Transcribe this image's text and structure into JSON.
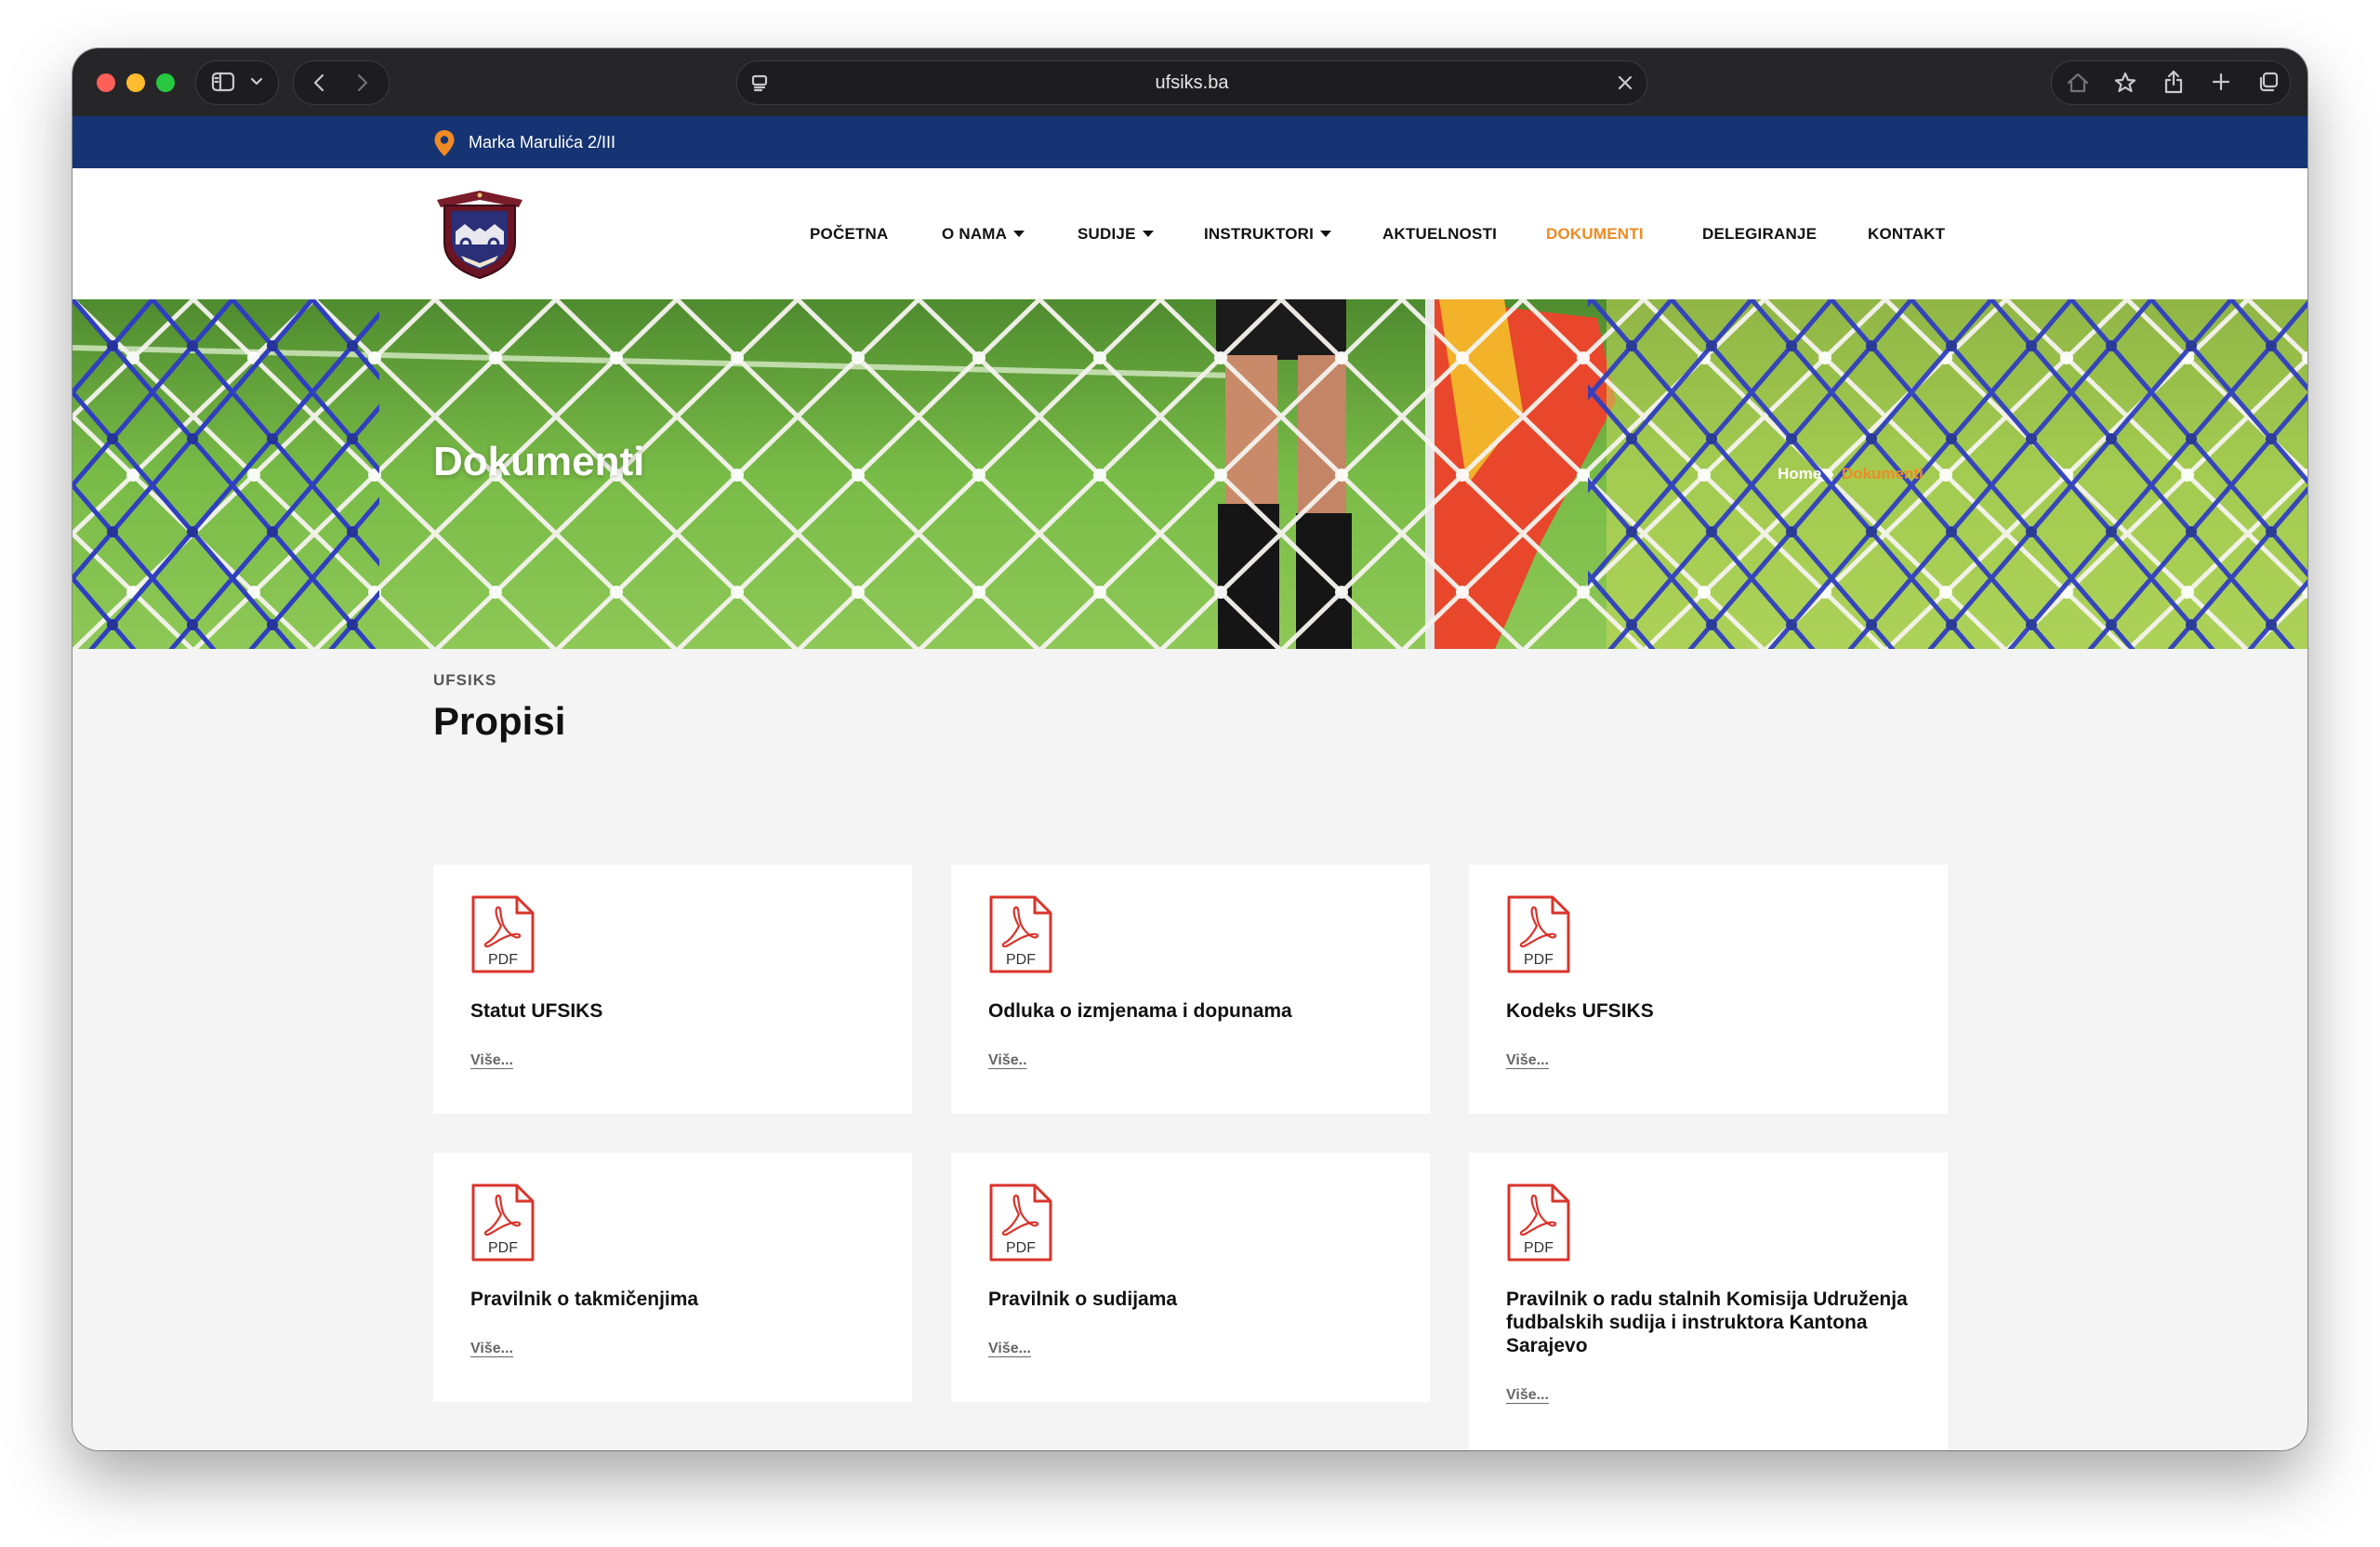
{
  "browser": {
    "url": "ufsiks.ba"
  },
  "topbar": {
    "address": "Marka Marulića 2/III"
  },
  "nav": {
    "items": [
      {
        "label": "POČETNA",
        "dropdown": false,
        "active": false
      },
      {
        "label": "O NAMA",
        "dropdown": true,
        "active": false
      },
      {
        "label": "SUDIJE",
        "dropdown": true,
        "active": false
      },
      {
        "label": "INSTRUKTORI",
        "dropdown": true,
        "active": false
      },
      {
        "label": "AKTUELNOSTI",
        "dropdown": false,
        "active": false
      },
      {
        "label": "DOKUMENTI",
        "dropdown": false,
        "active": true
      },
      {
        "label": "DELEGIRANJE",
        "dropdown": false,
        "active": false
      },
      {
        "label": "KONTAKT",
        "dropdown": false,
        "active": false
      }
    ]
  },
  "hero": {
    "title": "Dokumenti",
    "breadcrumb": {
      "home": "Home",
      "separator": "›",
      "current": "Dokumenti"
    }
  },
  "section": {
    "eyebrow": "UFSIKS",
    "title": "Propisi"
  },
  "documents": [
    {
      "icon": "pdf-file-icon",
      "badge": "PDF",
      "title": "Statut UFSIKS",
      "link": "Više..."
    },
    {
      "icon": "pdf-file-icon",
      "badge": "PDF",
      "title": "Odluka o izmjenama i dopunama",
      "link": "Više.."
    },
    {
      "icon": "pdf-file-icon",
      "badge": "PDF",
      "title": "Kodeks UFSIKS",
      "link": "Više..."
    },
    {
      "icon": "pdf-file-icon",
      "badge": "PDF",
      "title": "Pravilnik o takmičenjima",
      "link": "Više..."
    },
    {
      "icon": "pdf-file-icon",
      "badge": "PDF",
      "title": "Pravilnik o sudijama",
      "link": "Više..."
    },
    {
      "icon": "pdf-file-icon",
      "badge": "PDF",
      "title": "Pravilnik o radu stalnih Komisija Udruženja fudbalskih sudija i instruktora Kantona Sarajevo",
      "link": "Više..."
    }
  ],
  "colors": {
    "topbar": "#163473",
    "accent": "#f08a24",
    "pdf_red": "#d9342b"
  }
}
